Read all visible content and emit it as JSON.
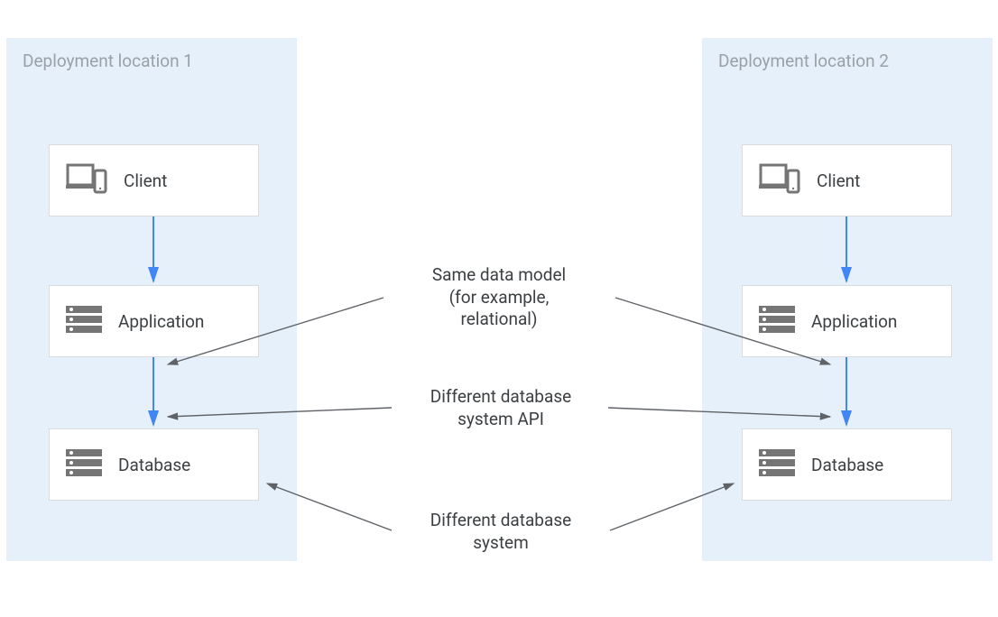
{
  "regions": {
    "left": {
      "title": "Deployment location 1"
    },
    "right": {
      "title": "Deployment location 2"
    }
  },
  "boxes": {
    "client": "Client",
    "application": "Application",
    "database": "Database"
  },
  "annotations": {
    "data_model_l1": "Same data model",
    "data_model_l2": "(for example,",
    "data_model_l3": "relational)",
    "api_l1": "Different database",
    "api_l2": "system API",
    "system_l1": "Different database",
    "system_l2": "system"
  }
}
